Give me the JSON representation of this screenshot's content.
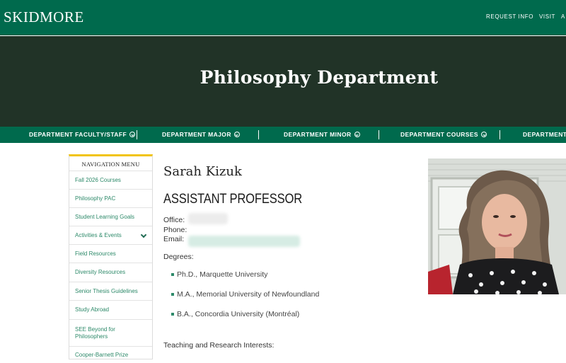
{
  "brand": {
    "logo": "SKIDMORE"
  },
  "topnav": {
    "items": [
      "REQUEST INFO",
      "VISIT",
      "A"
    ]
  },
  "hero": {
    "title": "Philosophy Department"
  },
  "dept_nav": {
    "items": [
      "DEPARTMENT FACULTY/STAFF",
      "DEPARTMENT MAJOR",
      "DEPARTMENT MINOR",
      "DEPARTMENT COURSES",
      "DEPARTMENT R"
    ]
  },
  "sidebar": {
    "heading": "NAVIGATION MENU",
    "items": [
      {
        "label": "Fall 2026 Courses"
      },
      {
        "label": "Philosophy PAC"
      },
      {
        "label": "Student Learning Goals"
      },
      {
        "label": "Activities & Events",
        "expandable": true
      },
      {
        "label": "Field Resources"
      },
      {
        "label": "Diversity Resources"
      },
      {
        "label": "Senior Thesis Guidelines"
      },
      {
        "label": "Study Abroad"
      },
      {
        "label": "SEE Beyond for Philosophers"
      },
      {
        "label": "Cooper-Barnett Prize"
      }
    ]
  },
  "profile": {
    "name": "Sarah Kizuk",
    "title": "ASSISTANT PROFESSOR",
    "office_label": "Office:",
    "phone_label": "Phone:",
    "email_label": "Email:",
    "degrees_label": "Degrees:",
    "degrees": [
      "Ph.D., Marquette University",
      "M.A., Memorial University of Newfoundland",
      "B.A., Concordia University (Montréal)"
    ],
    "interests_label": "Teaching and Research Interests:"
  },
  "colors": {
    "brand_green": "#006a4d",
    "hero_dark": "#213327",
    "accent_yellow": "#f1c40f",
    "link_green": "#2e8a6a"
  }
}
